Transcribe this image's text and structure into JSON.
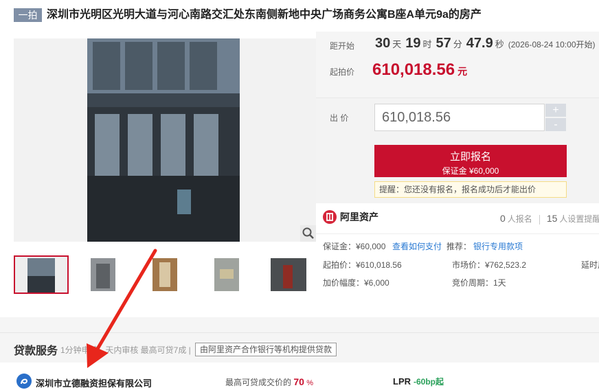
{
  "header": {
    "tag": "一拍",
    "title": "深圳市光明区光明大道与河心南路交汇处东南侧新地中央广场商务公寓B座A单元9a的房产"
  },
  "countdown": {
    "label": "距开始",
    "days": "30",
    "days_unit": "天",
    "hours": "19",
    "hours_unit": "时",
    "minutes": "57",
    "minutes_unit": "分",
    "seconds": "47.9",
    "seconds_unit": "秒",
    "start_note": "(2026-08-24 10:00开始)"
  },
  "start_price": {
    "label": "起拍价",
    "value": "610,018.56",
    "unit": "元"
  },
  "bid": {
    "label": "出 价",
    "value": "610,018.56",
    "plus": "+",
    "minus": "-",
    "signup_label": "立即报名",
    "deposit_label": "保证金 ¥60,000",
    "tip": "提醒：您还没有报名，报名成功后才能出价"
  },
  "brand": {
    "name": "阿里资产",
    "signups": "0",
    "signups_label": "人报名",
    "reminders": "15",
    "reminders_label": "人设置提醒"
  },
  "info": {
    "deposit": "保证金：¥60,000",
    "how_to_pay": "查看如何支付",
    "recommend_label": "推荐：",
    "recommend_link": "银行专用款项",
    "start_price": "起拍价：¥610,018.56",
    "market_price": "市场价：¥762,523.2",
    "delay": "延时周",
    "increment": "加价幅度：¥6,000",
    "cycle": "竞价周期：1天"
  },
  "loan": {
    "title": "贷款服务",
    "desc": "1分钟申请 · 天内审核 最高可贷7成 |",
    "badge": "由阿里资产合作银行等机构提供贷款",
    "company": "深圳市立德融资担保有限公司",
    "ratio_label": "最高可贷成交价的",
    "ratio": "70",
    "ratio_unit": "%",
    "lpr_label": "LPR",
    "lpr_value": "-60bp起"
  },
  "colors": {
    "accent_red": "#c8102e",
    "link_blue": "#2a7ad3",
    "arrow_red": "#e8261c"
  }
}
